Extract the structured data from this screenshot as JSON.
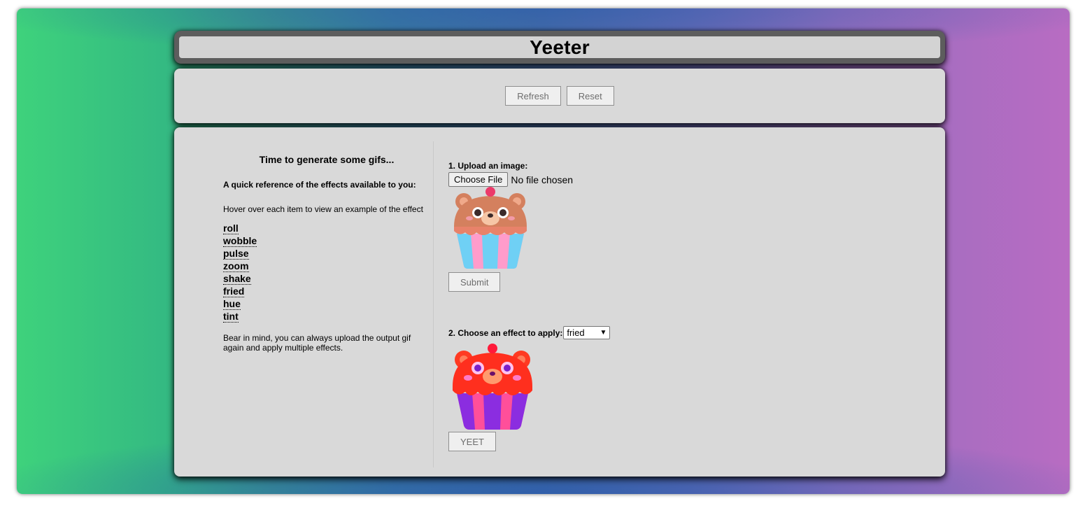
{
  "app": {
    "title": "Yeeter"
  },
  "controls": {
    "refresh_label": "Refresh",
    "reset_label": "Reset"
  },
  "reference": {
    "heading": "Time to generate some gifs...",
    "subheading": "A quick reference of the effects available to you:",
    "hover_hint": "Hover over each item to view an example of the effect",
    "effects": [
      "roll",
      "wobble",
      "pulse",
      "zoom",
      "shake",
      "fried",
      "hue",
      "tint"
    ],
    "note": "Bear in mind, you can always upload the output gif again and apply multiple effects."
  },
  "upload": {
    "label": "1. Upload an image:",
    "choose_file_label": "Choose File",
    "file_status": "No file chosen",
    "submit_label": "Submit",
    "preview_icon": "cupcake-bear-image"
  },
  "effect": {
    "label": "2. Choose an effect to apply:",
    "selected": "fried",
    "yeet_label": "YEET",
    "preview_icon": "fried-cupcake-bear-image"
  },
  "colors": {
    "panel_bg": "#d9d9d9",
    "title_frame": "#5d5d5d",
    "gradient_left": "#3ed27c",
    "gradient_right": "#b86cc2"
  }
}
